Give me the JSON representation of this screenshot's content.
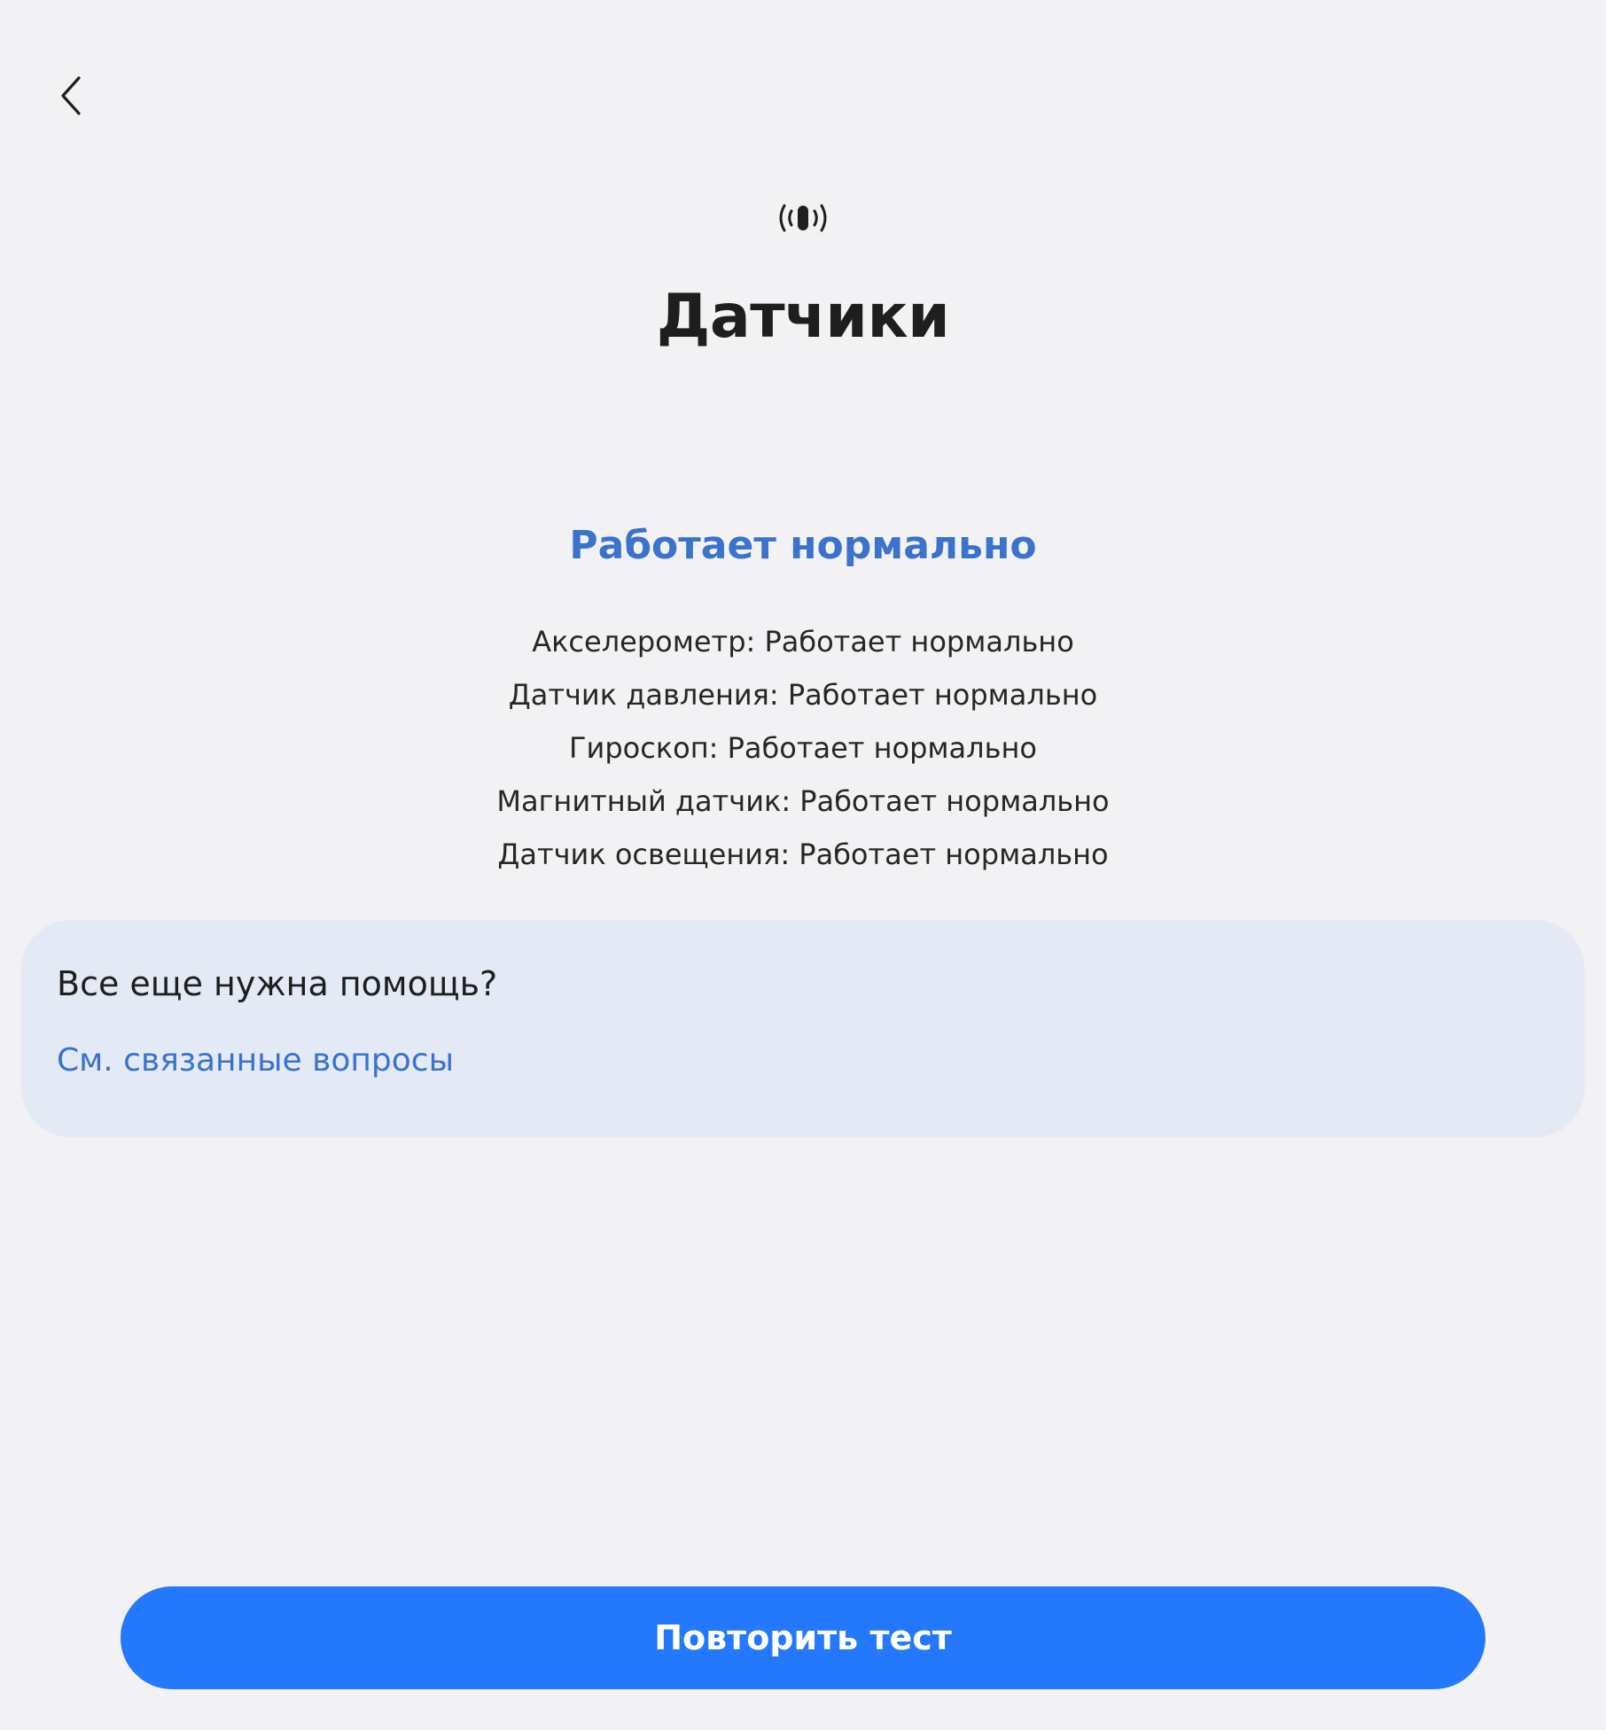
{
  "header": {
    "back_icon": "chevron-left-icon",
    "sensor_icon": "vibration-sensor-icon",
    "title": "Датчики"
  },
  "result": {
    "status": "Работает нормально",
    "status_color": "#3b72cc",
    "items": [
      "Акселерометр: Работает нормально",
      "Датчик давления: Работает нормально",
      "Гироскоп: Работает нормально",
      "Магнитный датчик: Работает нормально",
      "Датчик освещения: Работает нормально"
    ]
  },
  "help": {
    "title": "Все еще нужна помощь?",
    "link": "См. связанные вопросы",
    "card_color": "#e3e9f5"
  },
  "footer": {
    "retry_label": "Повторить тест",
    "button_color": "#2478fb"
  }
}
